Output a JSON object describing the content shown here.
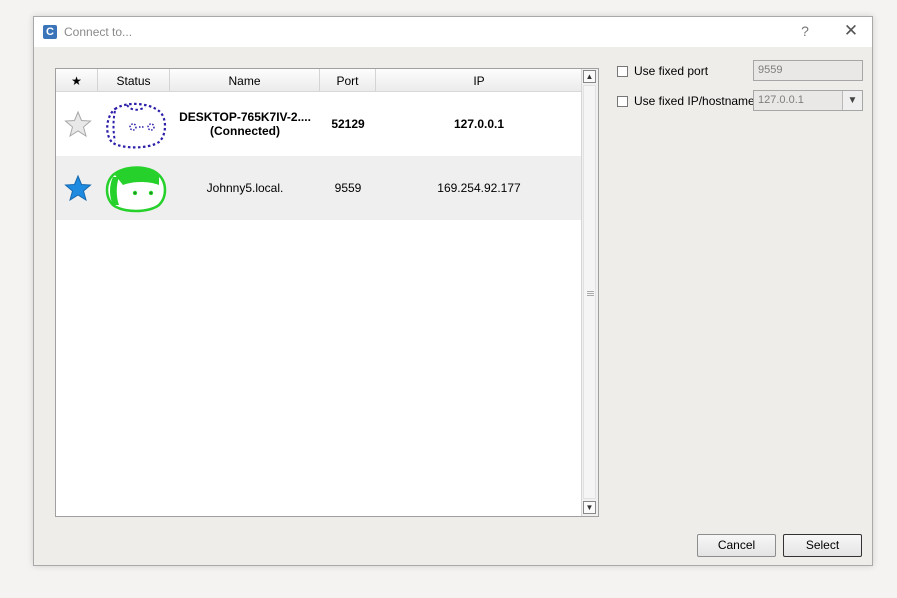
{
  "window": {
    "title": "Connect to...",
    "app_icon_letter": "C",
    "help_label": "?",
    "close_label": "✕"
  },
  "table": {
    "columns": [
      "★",
      "Status",
      "Name",
      "Port",
      "IP"
    ],
    "rows": [
      {
        "favorite": false,
        "star": "★",
        "status_icon": "robot-disconnected-outline-icon",
        "name": "DESKTOP-765K7IV-2....",
        "name_sub": "(Connected)",
        "port": "52129",
        "ip": "127.0.0.1",
        "bold": true
      },
      {
        "favorite": true,
        "star": "★",
        "status_icon": "robot-online-green-icon",
        "name": "Johnny5.local.",
        "name_sub": "",
        "port": "9559",
        "ip": "169.254.92.177",
        "bold": false
      }
    ]
  },
  "options": {
    "fixed_port_label": "Use fixed port",
    "fixed_port_checked": false,
    "fixed_port_value": "9559",
    "fixed_ip_label": "Use fixed IP/hostname",
    "fixed_ip_checked": false,
    "fixed_ip_value": "127.0.0.1"
  },
  "buttons": {
    "cancel": "Cancel",
    "select": "Select"
  },
  "colors": {
    "favorite_star": "#1e8be0",
    "unfavorite_star": "#bdbdbd",
    "robot_outline": "#2b1ea8",
    "robot_green": "#27d12b"
  }
}
